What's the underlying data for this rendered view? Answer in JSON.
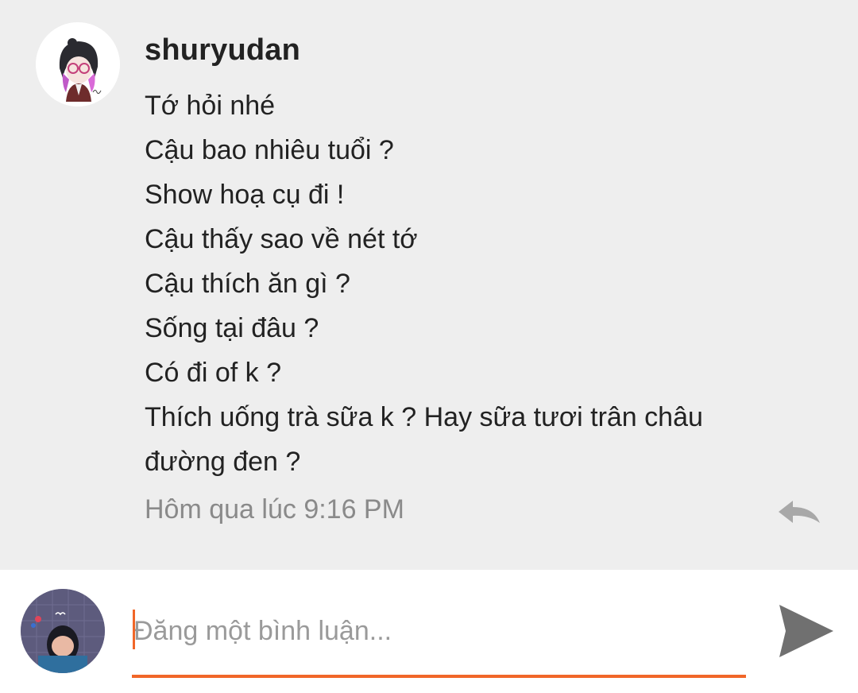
{
  "comment": {
    "author": "shuryudan",
    "lines": [
      "Tớ hỏi nhé",
      "Cậu bao nhiêu tuổi ?",
      "Show hoạ cụ đi !",
      "Cậu thấy sao về nét tớ",
      "Cậu thích ăn gì ?",
      "Sống tại đâu ?",
      "Có đi of k ?",
      "Thích uống trà sữa  k ? Hay sữa tươi trân châu",
      "đường đen ?"
    ],
    "timestamp": "Hôm qua lúc 9:16 PM",
    "reply_icon": "reply-arrow-icon"
  },
  "composer": {
    "placeholder": "Đăng một bình luận...",
    "value": "",
    "send_icon": "send-paper-plane-icon"
  },
  "colors": {
    "panel_bg": "#eeeeee",
    "accent": "#f16628",
    "text": "#222222",
    "muted": "#8a8a8a"
  }
}
